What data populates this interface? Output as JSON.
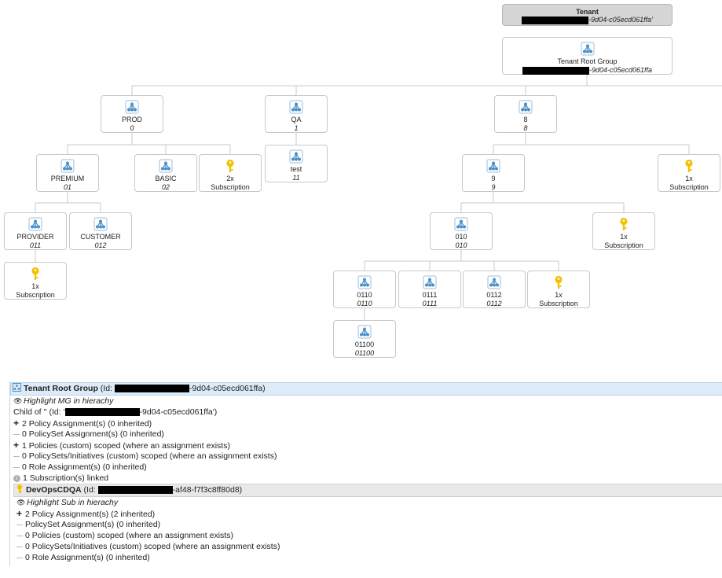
{
  "tenant": {
    "title": "Tenant",
    "id_suffix": "-9d04-c05ecd061ffa'"
  },
  "root": {
    "name": "Tenant Root Group",
    "id_suffix": "-9d04-c05ecd061ffa"
  },
  "nodes": {
    "prod": {
      "name": "PROD",
      "id": "0"
    },
    "qa": {
      "name": "QA",
      "id": "1"
    },
    "n8": {
      "name": "8",
      "id": "8"
    },
    "premium": {
      "name": "PREMIUM",
      "id": "01"
    },
    "basic": {
      "name": "BASIC",
      "id": "02"
    },
    "sub_prod": {
      "count": "2x",
      "label": "Subscription"
    },
    "test": {
      "name": "test",
      "id": "11"
    },
    "n9": {
      "name": "9",
      "id": "9"
    },
    "sub_8": {
      "count": "1x",
      "label": "Subscription"
    },
    "provider": {
      "name": "PROVIDER",
      "id": "011"
    },
    "customer": {
      "name": "CUSTOMER",
      "id": "012"
    },
    "n010": {
      "name": "010",
      "id": "010"
    },
    "sub_9": {
      "count": "1x",
      "label": "Subscription"
    },
    "sub_provider": {
      "count": "1x",
      "label": "Subscription"
    },
    "n0110": {
      "name": "0110",
      "id": "0110"
    },
    "n0111": {
      "name": "0111",
      "id": "0111"
    },
    "n0112": {
      "name": "0112",
      "id": "0112"
    },
    "sub_010": {
      "count": "1x",
      "label": "Subscription"
    },
    "n01100": {
      "name": "01100",
      "id": "01100"
    }
  },
  "details": {
    "mg": {
      "title": "Tenant Root Group",
      "id_prefix": "(Id: ",
      "id_suffix": "-9d04-c05ecd061ffa)",
      "highlight": "Highlight MG in hierachy",
      "child_of_prefix": "Child of '' (Id: '",
      "child_of_suffix": "-9d04-c05ecd061ffa')",
      "policy_assignments": "2 Policy Assignment(s) (0 inherited)",
      "policyset_assignments": "0 PolicySet Assignment(s) (0 inherited)",
      "policies_custom": "1 Policies (custom) scoped (where an assignment exists)",
      "policysets_custom": "0 PolicySets/Initiatives (custom) scoped (where an assignment exists)",
      "role_assignments": "0 Role Assignment(s) (0 inherited)",
      "subscriptions_linked": "1 Subscription(s) linked"
    },
    "sub": {
      "title": "DevOpsCDQA",
      "id_prefix": "(Id: ",
      "id_suffix": "-af48-f7f3c8ff80d8)",
      "highlight": "Highlight Sub in hierachy",
      "policy_assignments": "2 Policy Assignment(s) (2 inherited)",
      "policyset_assignments": "PolicySet Assignment(s) (0 inherited)",
      "policies_custom": "0 Policies (custom) scoped (where an assignment exists)",
      "policysets_custom": "0 PolicySets/Initiatives (custom) scoped (where an assignment exists)",
      "role_assignments": "0 Role Assignment(s) (0 inherited)"
    }
  },
  "colors": {
    "icon_blue": "#4a90c8",
    "key_gold": "#f2c200",
    "link_gray": "#c8c8c8",
    "header_blue": "#dcebf7"
  }
}
